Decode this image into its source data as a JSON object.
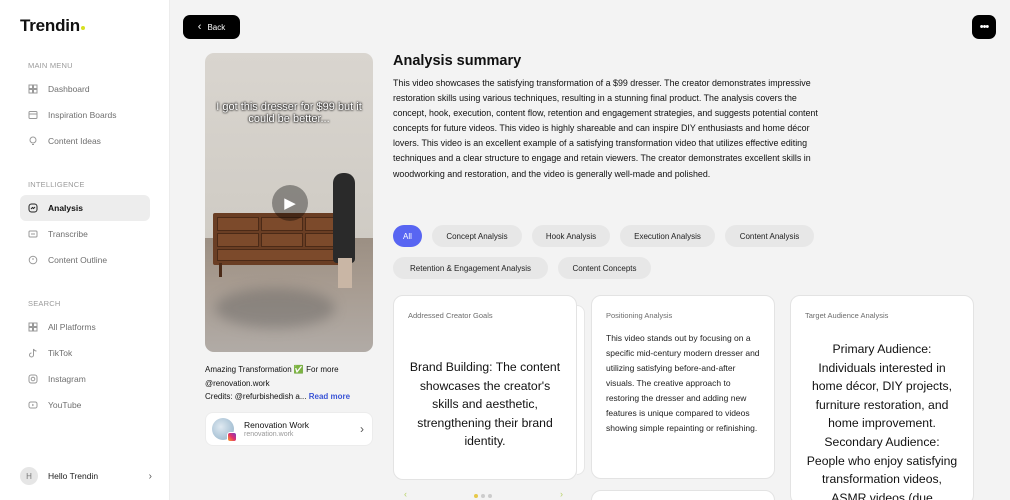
{
  "app": {
    "logo": "Trendin"
  },
  "sidebar": {
    "main_menu_label": "MAIN MENU",
    "intelligence_label": "INTELLIGENCE",
    "search_label": "SEARCH",
    "items": [
      {
        "label": "Dashboard",
        "icon": "dashboard-icon"
      },
      {
        "label": "Inspiration Boards",
        "icon": "board-icon"
      },
      {
        "label": "Content Ideas",
        "icon": "lightbulb-icon"
      },
      {
        "label": "Analysis",
        "icon": "analysis-icon",
        "active": true
      },
      {
        "label": "Transcribe",
        "icon": "transcribe-icon"
      },
      {
        "label": "Content Outline",
        "icon": "outline-icon"
      },
      {
        "label": "All Platforms",
        "icon": "grid-icon"
      },
      {
        "label": "TikTok",
        "icon": "tiktok-icon"
      },
      {
        "label": "Instagram",
        "icon": "instagram-icon"
      },
      {
        "label": "YouTube",
        "icon": "youtube-icon"
      }
    ],
    "user": {
      "initial": "H",
      "name": "Hello Trendin"
    }
  },
  "toolbar": {
    "back_label": "Back",
    "more_icon": "more-icon"
  },
  "video": {
    "caption": "I got this dresser for $99 but it could be better...",
    "description_line1": "Amazing Transformation ✅ For more",
    "description_line2": "@renovation.work",
    "description_line3": "Credits: @refurbishedish a...",
    "read_more": "Read more",
    "account_name": "Renovation Work",
    "account_handle": "renovation.work"
  },
  "summary": {
    "title": "Analysis summary",
    "text": "This video showcases the satisfying transformation of a $99 dresser. The creator demonstrates impressive restoration skills using various techniques, resulting in a stunning final product. The analysis covers the concept, hook, execution, content flow, retention and engagement strategies, and suggests potential content concepts for future videos. This video is highly shareable and can inspire DIY enthusiasts and home décor lovers. This video is an excellent example of a satisfying transformation video that utilizes effective editing techniques and a clear structure to engage and retain viewers. The creator demonstrates excellent skills in woodworking and restoration, and the video is generally well-made and polished."
  },
  "filters": [
    {
      "label": "All",
      "active": true
    },
    {
      "label": "Concept Analysis"
    },
    {
      "label": "Hook Analysis"
    },
    {
      "label": "Execution Analysis"
    },
    {
      "label": "Content Analysis"
    },
    {
      "label": "Retention & Engagement Analysis"
    },
    {
      "label": "Content Concepts"
    }
  ],
  "cards": [
    {
      "title": "Addressed Creator Goals",
      "body": "Brand Building: The content showcases the creator's skills and aesthetic, strengthening their brand identity."
    },
    {
      "title": "Positioning Analysis",
      "body": "This video stands out by focusing on a specific mid-century modern dresser and utilizing satisfying before-and-after visuals. The creative approach to restoring the dresser and adding new features is unique compared to videos showing simple repainting or refinishing."
    },
    {
      "title": "Target Audience Analysis",
      "body_line1": "Primary Audience:",
      "body_line2": "Individuals interested in home décor, DIY projects, furniture restoration, and home improvement.",
      "body_line3": "Secondary Audience:",
      "body_line4": "People who enjoy satisfying transformation videos, ASMR videos (due"
    }
  ],
  "colors": {
    "accent": "#5865f2",
    "link": "#3b55d6",
    "logo_dot": "#d7e021"
  }
}
